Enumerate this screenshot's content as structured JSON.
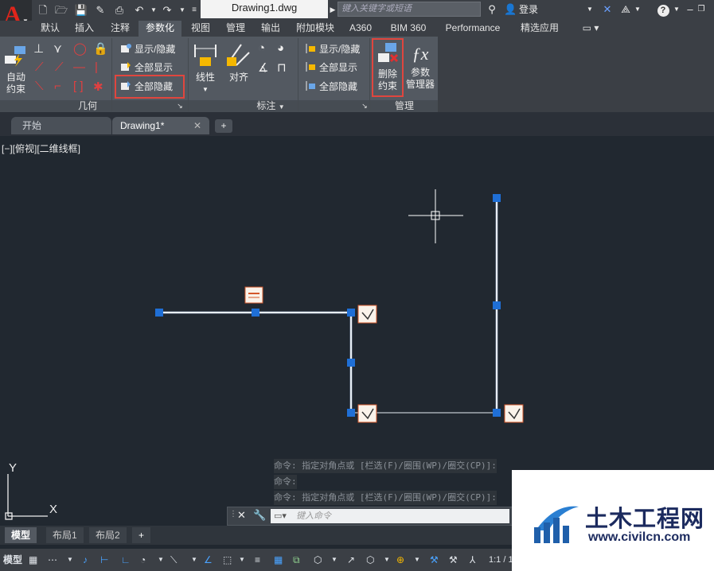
{
  "title_bar": {
    "doc_title": "Drawing1.dwg",
    "search_placeholder": "键入关键字或短语",
    "login": "登录"
  },
  "ribbon_tabs": [
    "默认",
    "插入",
    "注释",
    "参数化",
    "视图",
    "管理",
    "输出",
    "附加模块",
    "A360",
    "BIM 360",
    "Performance",
    "精选应用"
  ],
  "active_tab": "参数化",
  "ribbon": {
    "auto_constrain": [
      "自动",
      "约束"
    ],
    "geometric": {
      "show_hide": "显示/隐藏",
      "show_all": "全部显示",
      "hide_all": "全部隐藏",
      "panel_name": "几何"
    },
    "dimensional": {
      "linear": "线性",
      "aligned": "对齐",
      "show_hide": "显示/隐藏",
      "show_all": "全部显示",
      "hide_all": "全部隐藏",
      "panel_name": "标注"
    },
    "manage": {
      "delete_constraints": [
        "删除",
        "约束"
      ],
      "param_manager": [
        "参数",
        "管理器"
      ],
      "panel_name": "管理"
    }
  },
  "file_tabs": {
    "start": "开始",
    "drawing": "Drawing1*"
  },
  "viewport_label": "[−][俯视][二维线框]",
  "ucs": {
    "y": "Y",
    "x": "X"
  },
  "command_history": [
    "命令: 指定对角点或 [栏选(F)/圈围(WP)/圈交(CP)]:",
    "命令:",
    "命令: 指定对角点或 [栏选(F)/圈围(WP)/圈交(CP)]:"
  ],
  "command_placeholder": "键入命令",
  "layout_tabs": [
    "模型",
    "布局1",
    "布局2"
  ],
  "status": {
    "model": "模型",
    "scale": "1:1 / 1"
  },
  "watermark": {
    "cn": "土木工程网",
    "url": "www.civilcn.com"
  },
  "colors": {
    "accent_red": "#e0463e",
    "grip_blue": "#1f6fd6",
    "line": "#e8eef5"
  }
}
